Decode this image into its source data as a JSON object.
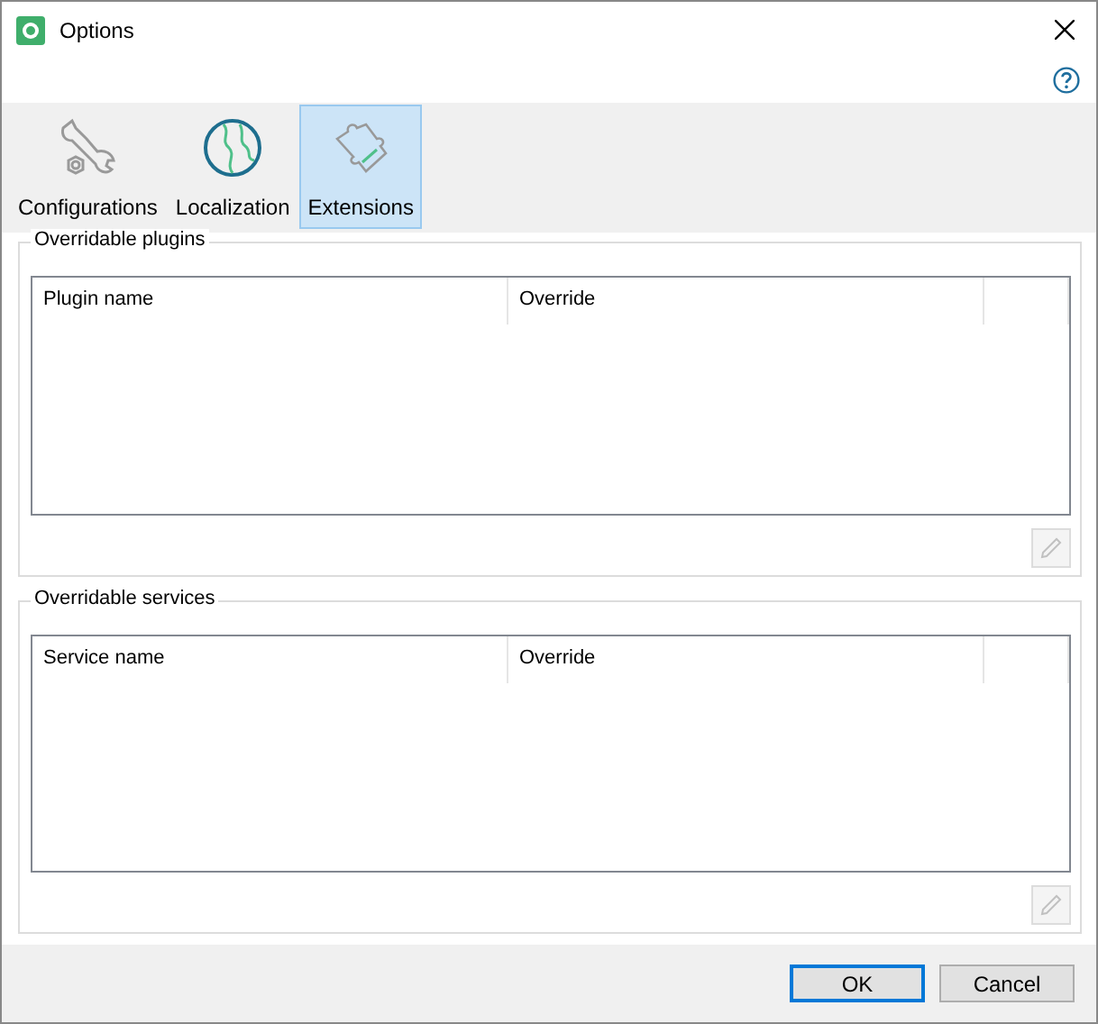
{
  "window": {
    "title": "Options"
  },
  "tabs": [
    {
      "label": "Configurations",
      "kind": "wrench",
      "selected": false
    },
    {
      "label": "Localization",
      "kind": "globe",
      "selected": false
    },
    {
      "label": "Extensions",
      "kind": "puzzle",
      "selected": true
    }
  ],
  "groups": [
    {
      "title": "Overridable plugins",
      "columns": [
        "Plugin name",
        "Override"
      ],
      "edit_disabled": true
    },
    {
      "title": "Overridable services",
      "columns": [
        "Service name",
        "Override"
      ],
      "edit_disabled": true
    }
  ],
  "buttons": [
    {
      "label": "OK",
      "default": true
    },
    {
      "label": "Cancel",
      "default": false
    }
  ]
}
